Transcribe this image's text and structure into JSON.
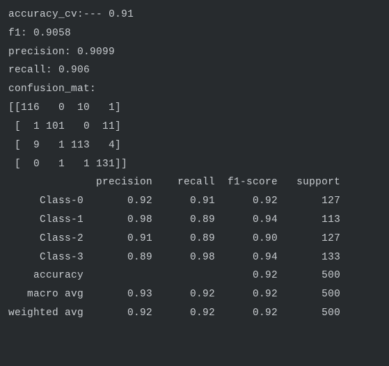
{
  "metrics": {
    "accuracy_cv_label": "accuracy_cv:",
    "accuracy_cv_dashes": "---",
    "accuracy_cv_value": "0.91",
    "f1_label": "f1:",
    "f1_value": "0.9058",
    "precision_label": "precision:",
    "precision_value": "0.9099",
    "recall_label": "recall:",
    "recall_value": "0.906",
    "confusion_mat_label": "confusion_mat:"
  },
  "confusion_matrix": {
    "row0": "[[116   0  10   1]",
    "row1": " [  1 101   0  11]",
    "row2": " [  9   1 113   4]",
    "row3": " [  0   1   1 131]]"
  },
  "report": {
    "header": "              precision    recall  f1-score   support",
    "blank1": "",
    "class0": "     Class-0       0.92      0.91      0.92       127",
    "class1": "     Class-1       0.98      0.89      0.94       113",
    "class2": "     Class-2       0.91      0.89      0.90       127",
    "class3": "     Class-3       0.89      0.98      0.94       133",
    "blank2": "",
    "accuracy": "    accuracy                           0.92       500",
    "macro_avg": "   macro avg       0.93      0.92      0.92       500",
    "weighted_avg": "weighted avg       0.92      0.92      0.92       500"
  },
  "chart_data": {
    "type": "table",
    "title": "Classification Report",
    "metrics": {
      "accuracy_cv": 0.91,
      "f1": 0.9058,
      "precision": 0.9099,
      "recall": 0.906
    },
    "confusion_matrix": [
      [
        116,
        0,
        10,
        1
      ],
      [
        1,
        101,
        0,
        11
      ],
      [
        9,
        1,
        113,
        4
      ],
      [
        0,
        1,
        1,
        131
      ]
    ],
    "columns": [
      "precision",
      "recall",
      "f1-score",
      "support"
    ],
    "rows": [
      {
        "label": "Class-0",
        "precision": 0.92,
        "recall": 0.91,
        "f1-score": 0.92,
        "support": 127
      },
      {
        "label": "Class-1",
        "precision": 0.98,
        "recall": 0.89,
        "f1-score": 0.94,
        "support": 113
      },
      {
        "label": "Class-2",
        "precision": 0.91,
        "recall": 0.89,
        "f1-score": 0.9,
        "support": 127
      },
      {
        "label": "Class-3",
        "precision": 0.89,
        "recall": 0.98,
        "f1-score": 0.94,
        "support": 133
      }
    ],
    "summary": [
      {
        "label": "accuracy",
        "precision": null,
        "recall": null,
        "f1-score": 0.92,
        "support": 500
      },
      {
        "label": "macro avg",
        "precision": 0.93,
        "recall": 0.92,
        "f1-score": 0.92,
        "support": 500
      },
      {
        "label": "weighted avg",
        "precision": 0.92,
        "recall": 0.92,
        "f1-score": 0.92,
        "support": 500
      }
    ]
  }
}
